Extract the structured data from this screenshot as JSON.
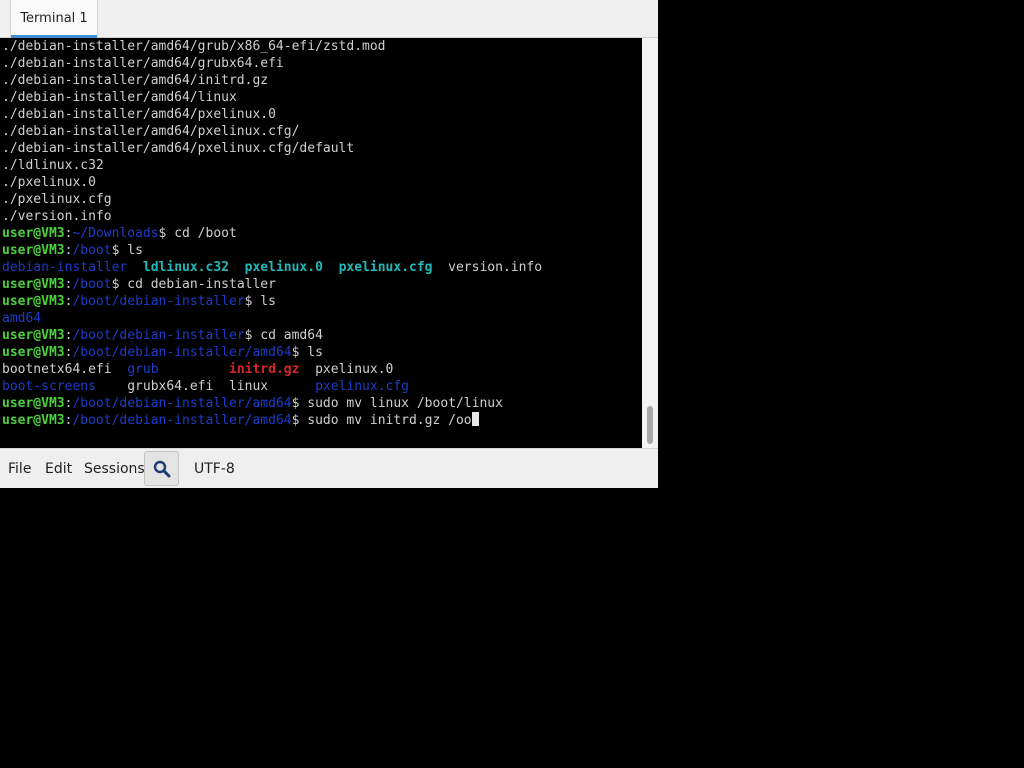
{
  "tabs": [
    {
      "label": "Terminal 1"
    }
  ],
  "terminal": {
    "output": [
      "./debian-installer/amd64/grub/x86_64-efi/zstd.mod",
      "./debian-installer/amd64/grubx64.efi",
      "./debian-installer/amd64/initrd.gz",
      "./debian-installer/amd64/linux",
      "./debian-installer/amd64/pxelinux.0",
      "./debian-installer/amd64/pxelinux.cfg/",
      "./debian-installer/amd64/pxelinux.cfg/default",
      "./ldlinux.c32",
      "./pxelinux.0",
      "./pxelinux.cfg",
      "./version.info"
    ],
    "prompt_user": "user@VM3",
    "prompt_sep": ":",
    "prompt_end": "$",
    "session": [
      {
        "path": "~/Downloads",
        "cmd": " cd /boot"
      },
      {
        "path": "/boot",
        "cmd": " ls"
      },
      {
        "ls": [
          {
            "text": "debian-installer",
            "style": "dir"
          },
          {
            "text": "  "
          },
          {
            "text": "ldlinux.c32",
            "style": "cyan"
          },
          {
            "text": "  "
          },
          {
            "text": "pxelinux.0",
            "style": "cyan"
          },
          {
            "text": "  "
          },
          {
            "text": "pxelinux.cfg",
            "style": "cyan"
          },
          {
            "text": "  version.info"
          }
        ]
      },
      {
        "path": "/boot",
        "cmd": " cd debian-installer"
      },
      {
        "path": "/boot/debian-installer",
        "cmd": " ls"
      },
      {
        "ls": [
          {
            "text": "amd64",
            "style": "dir"
          }
        ]
      },
      {
        "path": "/boot/debian-installer",
        "cmd": " cd amd64"
      },
      {
        "path": "/boot/debian-installer/amd64",
        "cmd": " ls"
      },
      {
        "ls": [
          {
            "text": "bootnetx64.efi  "
          },
          {
            "text": "grub",
            "style": "dir"
          },
          {
            "text": "         "
          },
          {
            "text": "initrd.gz",
            "style": "red"
          },
          {
            "text": "  pxelinux.0"
          }
        ]
      },
      {
        "ls": [
          {
            "text": "boot-screens",
            "style": "dir"
          },
          {
            "text": "    grubx64.efi  linux      "
          },
          {
            "text": "pxelinux.cfg",
            "style": "dir"
          }
        ]
      },
      {
        "path": "/boot/debian-installer/amd64",
        "cmd": " sudo mv linux /boot/linux"
      },
      {
        "path": "/boot/debian-installer/amd64",
        "cmd": " sudo mv initrd.gz /oo",
        "cursor": true
      }
    ]
  },
  "menubar": {
    "file": "File",
    "edit": "Edit",
    "sessions": "Sessions",
    "search_icon": "search-icon",
    "encoding": "UTF-8"
  }
}
